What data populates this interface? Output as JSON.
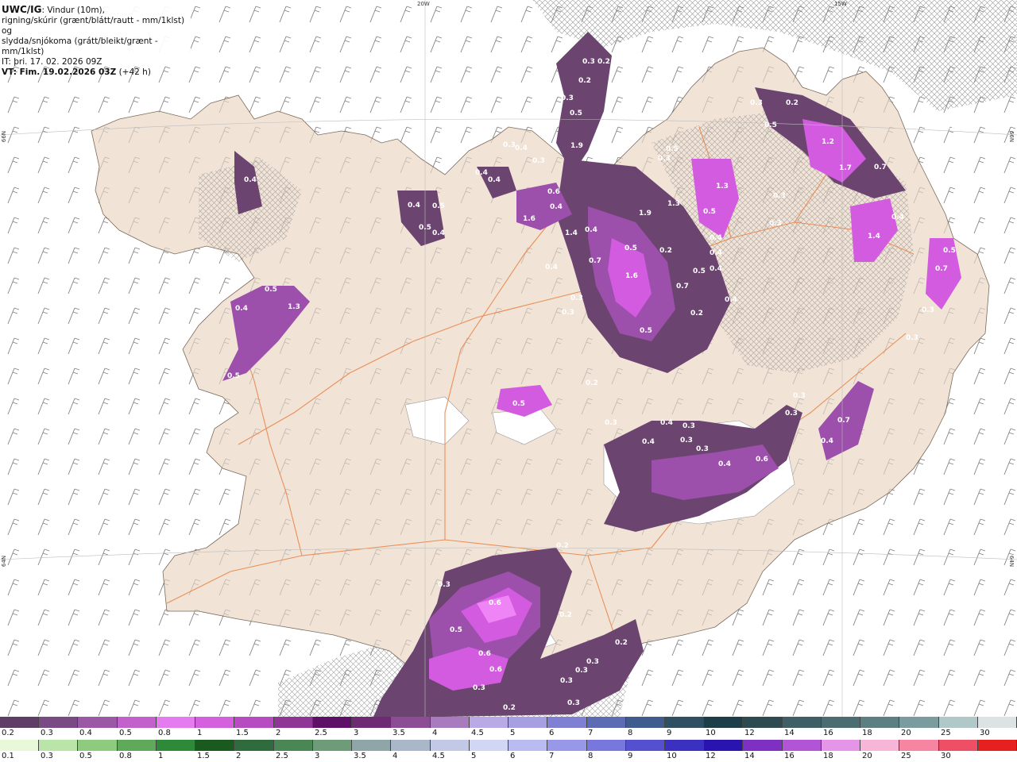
{
  "header": {
    "product": "UWC/IG",
    "line1_rest": ": Vindur (10m),",
    "line2": "rigning/skúrir (grænt/blátt/rautt - mm/1klst) og",
    "line3": "slydda/snjókoma (grátt/bleikt/grænt - mm/1klst)",
    "init_time": "IT: þri. 17. 02. 2026 09Z",
    "valid_time_bold": "VT: Fim. 19.02.2026 03Z",
    "valid_time_rest": " (+42 h)"
  },
  "gridlabels": {
    "lon_20w": "20W",
    "lon_15w": "15W",
    "lat_66n_left": "66N",
    "lat_66n_right": "66N",
    "lat_64n_left": "64N",
    "lat_64n_right": "64N"
  },
  "colors": {
    "land": "#f1e3d6",
    "sea": "#ffffff",
    "roads": "#e8874a",
    "precip_light": "#6b4470",
    "precip_mid": "#9c4fab",
    "precip_heavy": "#d35be0",
    "precip_peak": "#ef84f6"
  },
  "legend_snow": {
    "labels": [
      "0.2",
      "0.3",
      "0.4",
      "0.5",
      "0.8",
      "1",
      "1.5",
      "2",
      "2.5",
      "3",
      "3.5",
      "4",
      "4.5",
      "5",
      "6",
      "7",
      "8",
      "9",
      "10",
      "12",
      "14",
      "16",
      "18",
      "20",
      "25",
      "30"
    ],
    "colors": [
      "#5e3d66",
      "#7a4a85",
      "#9a58a5",
      "#c260cc",
      "#e47bee",
      "#d460dd",
      "#b74bc2",
      "#8e3595",
      "#5e0f66",
      "#6e2a73",
      "#8d4d95",
      "#a77bbd",
      "#b9a9e6",
      "#a6a0e3",
      "#7f7fd3",
      "#5d6bb5",
      "#405b8e",
      "#2f4f63",
      "#1c3e48",
      "#2d4a50",
      "#3f5f67",
      "#4b6c70",
      "#5c7f82",
      "#7b9c9e",
      "#b0c8c7",
      "#dce3e2"
    ]
  },
  "legend_rain": {
    "labels": [
      "0.1",
      "0.3",
      "0.5",
      "0.8",
      "1",
      "1.5",
      "2",
      "2.5",
      "3",
      "3.5",
      "4",
      "4.5",
      "5",
      "6",
      "7",
      "8",
      "9",
      "10",
      "12",
      "14",
      "16",
      "18",
      "20",
      "25",
      "30"
    ],
    "colors": [
      "#e7f9d9",
      "#b9e5a8",
      "#8fcb7e",
      "#5fa95a",
      "#2e8a38",
      "#1a5a1e",
      "#2f6b3c",
      "#4b8655",
      "#6e9c79",
      "#8ea6a8",
      "#a9b7c8",
      "#c1c9e6",
      "#d0d6f4",
      "#b8bcf0",
      "#9898e8",
      "#7777dd",
      "#5550cf",
      "#3a31c0",
      "#2a14b0",
      "#7e30c2",
      "#b254d6",
      "#e595e8",
      "#f7b6d8",
      "#f585a0",
      "#ee4f64",
      "#e61f1f"
    ]
  },
  "precip_labels": [
    "0.3",
    "0.2",
    "0.2",
    "0.3",
    "0.2",
    "0.5",
    "0.3",
    "0.4",
    "0.3",
    "0.5",
    "0.3",
    "0.4",
    "0.4",
    "0.3",
    "1.9",
    "1.5",
    "1.8",
    "0.5",
    "1.3",
    "0.3",
    "1.2",
    "1.7",
    "0.7",
    "0.4",
    "0.4",
    "0.4",
    "0.5",
    "0.5",
    "0.4",
    "0.4",
    "0.6",
    "1.6",
    "1.9",
    "0.5",
    "1.3",
    "1.4",
    "0.4",
    "1.4",
    "0.4",
    "0.7",
    "0.2",
    "0.5",
    "0.4",
    "0.4",
    "0.7",
    "0.5",
    "1.6",
    "0.4",
    "0.7",
    "0.4",
    "0.3",
    "0.5",
    "0.3",
    "0.5",
    "1.3",
    "0.4",
    "0.3",
    "0.5",
    "0.2",
    "0.3",
    "0.3",
    "0.4",
    "0.3",
    "0.4",
    "0.6",
    "0.7",
    "0.3",
    "0.5",
    "0.3",
    "0.4",
    "0.4",
    "0.3",
    "0.4",
    "0.3",
    "0.3",
    "0.2",
    "0.3",
    "0.2",
    "0.5",
    "0.2",
    "0.6",
    "0.5",
    "0.6",
    "0.6",
    "0.3",
    "0.3",
    "0.3",
    "0.3",
    "0.3",
    "0.2",
    "0.3",
    "0.2"
  ]
}
